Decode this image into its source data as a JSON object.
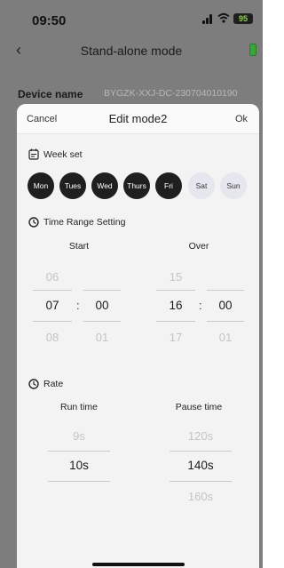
{
  "status": {
    "time": "09:50",
    "battery": "95"
  },
  "header": {
    "title": "Stand-alone mode"
  },
  "device": {
    "label": "Device name",
    "value": "BYGZK-XXJ-DC-230704010190"
  },
  "modal": {
    "cancel_label": "Cancel",
    "title": "Edit mode2",
    "ok_label": "Ok",
    "week_set": {
      "label": "Week set",
      "days": [
        {
          "label": "Mon",
          "selected": true
        },
        {
          "label": "Tues",
          "selected": true
        },
        {
          "label": "Wed",
          "selected": true
        },
        {
          "label": "Thurs",
          "selected": true
        },
        {
          "label": "Fri",
          "selected": true
        },
        {
          "label": "Sat",
          "selected": false
        },
        {
          "label": "Sun",
          "selected": false
        }
      ]
    },
    "time_range": {
      "label": "Time Range Setting",
      "start_label": "Start",
      "over_label": "Over",
      "separator": ":",
      "start_hour": {
        "prev": "06",
        "value": "07",
        "next": "08"
      },
      "start_minute": {
        "prev": "",
        "value": "00",
        "next": "01"
      },
      "over_hour": {
        "prev": "15",
        "value": "16",
        "next": "17"
      },
      "over_minute": {
        "prev": "",
        "value": "00",
        "next": "01"
      }
    },
    "rate": {
      "label": "Rate",
      "run_label": "Run time",
      "pause_label": "Pause time",
      "run": {
        "prev": "9s",
        "value": "10s"
      },
      "pause": {
        "prev": "120s",
        "value": "140s",
        "next": "160s"
      }
    }
  },
  "colors": {
    "dim_bg": "#7d7d7d",
    "sheet_bg": "#f3f3f3",
    "day_on": "#1f1f1f",
    "day_off": "#e6e6ef",
    "battery_green": "#3aa43a"
  },
  "icons": [
    "back-chevron-icon",
    "signal-icon",
    "wifi-icon",
    "battery-icon",
    "calendar-icon",
    "clock-icon",
    "rate-clock-icon"
  ]
}
